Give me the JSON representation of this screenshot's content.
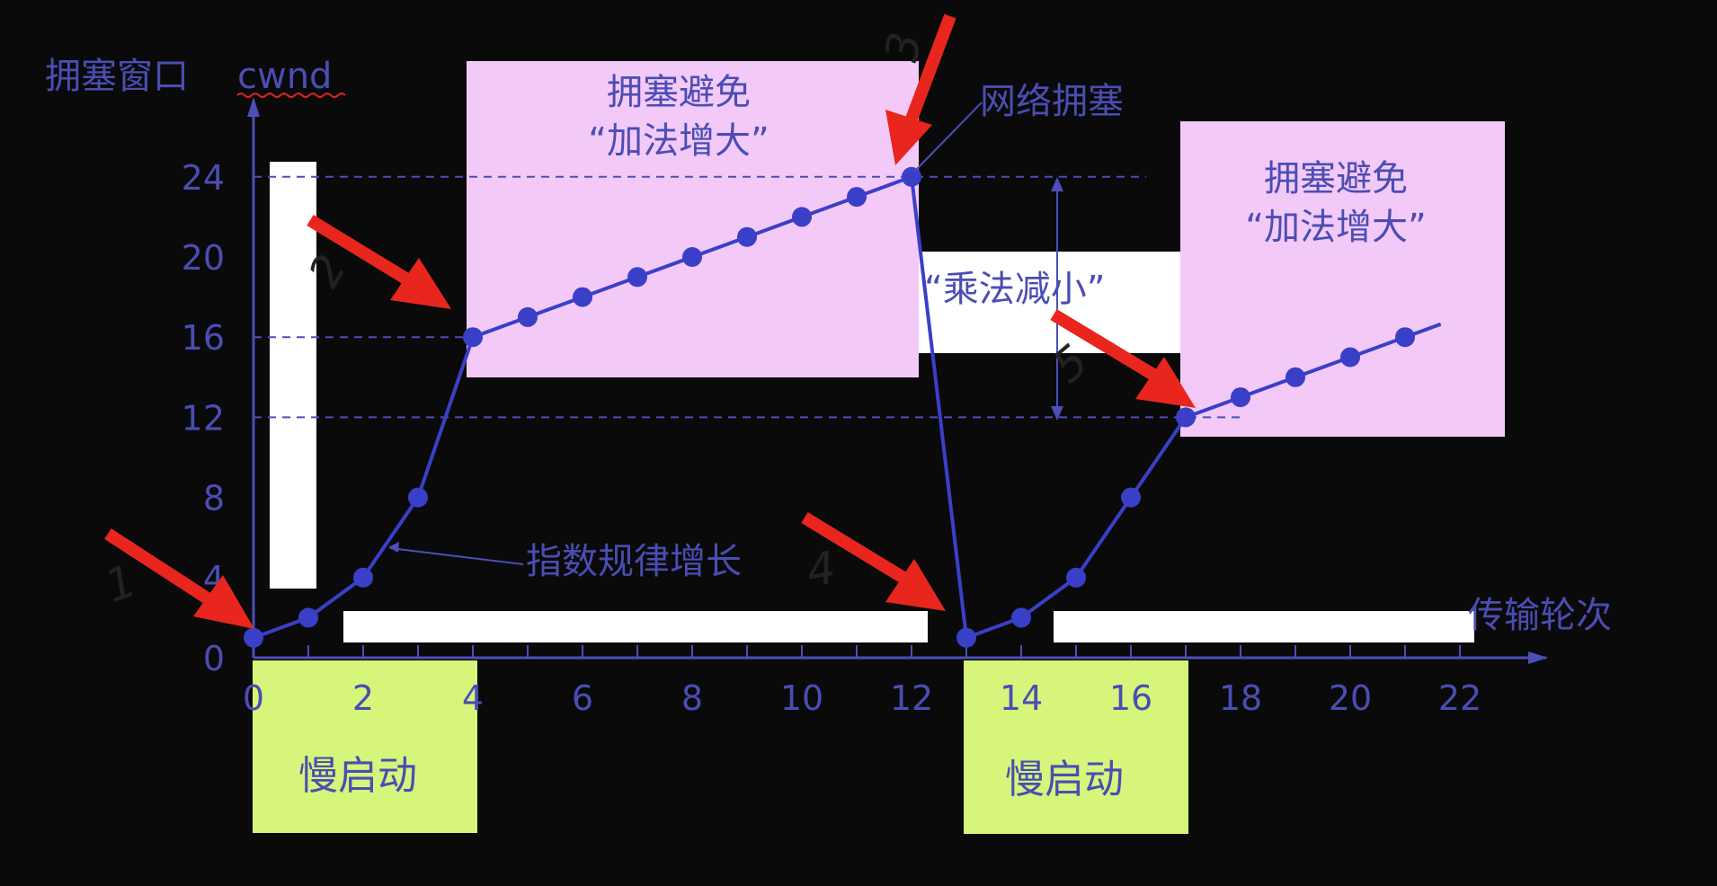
{
  "colors": {
    "background": "#0a0a0a",
    "axis": "#4b4fb8",
    "line": "#3a3fc8",
    "text": "#4a4db3",
    "avoid_box": "#f3c9f8",
    "slowstart_box": "#d6f57a",
    "arrow": "#e8261e",
    "white_box": "#ffffff",
    "handwriting": "#222222"
  },
  "labels": {
    "y_title": "拥塞窗口",
    "y_title_var": "cwnd",
    "x_title": "传输轮次",
    "avoid1_line1": "拥塞避免",
    "avoid1_line2": "“加法增大”",
    "avoid2_line1": "拥塞避免",
    "avoid2_line2": "“加法增大”",
    "congestion": "网络拥塞",
    "mult_decrease": "“乘法减小”",
    "exp_growth": "指数规律增长",
    "slow_start_1": "慢启动",
    "slow_start_2": "慢启动",
    "hand_1": "1",
    "hand_2": "2",
    "hand_3": "3",
    "hand_4": "4",
    "hand_5": "5"
  },
  "chart_data": {
    "type": "line",
    "xlabel": "传输轮次",
    "ylabel": "拥塞窗口 cwnd",
    "xlim": [
      0,
      23
    ],
    "ylim": [
      0,
      26
    ],
    "x_ticks": [
      0,
      2,
      4,
      6,
      8,
      10,
      12,
      14,
      16,
      18,
      20,
      22
    ],
    "y_ticks": [
      0,
      4,
      8,
      12,
      16,
      20,
      24
    ],
    "reference_lines_y": [
      24,
      16,
      12
    ],
    "series": [
      {
        "x": [
          0,
          1,
          2,
          3,
          4,
          5,
          6,
          7,
          8,
          9,
          10,
          11,
          12,
          13,
          14,
          15,
          16,
          17,
          18,
          19,
          20,
          21
        ],
        "values": [
          1,
          2,
          4,
          8,
          16,
          17,
          18,
          19,
          20,
          21,
          22,
          23,
          24,
          1,
          2,
          4,
          8,
          12,
          13,
          14,
          15,
          16
        ]
      }
    ]
  }
}
